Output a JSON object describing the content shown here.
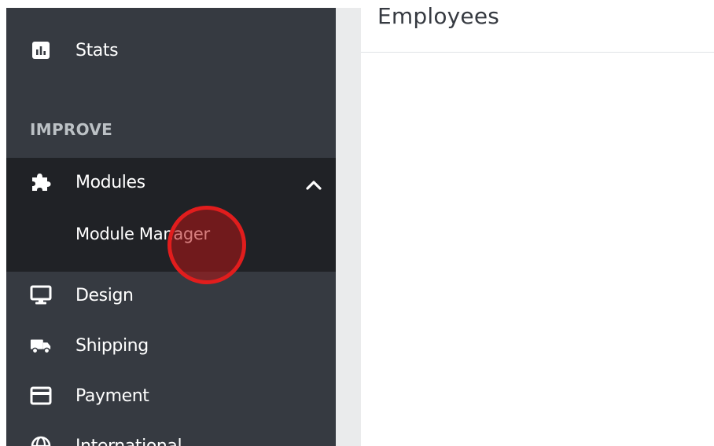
{
  "main": {
    "title": "Employees"
  },
  "sidebar": {
    "items_top": [
      {
        "label": "Stats",
        "icon": "stats-icon"
      }
    ],
    "section_title": "IMPROVE",
    "modules": {
      "label": "Modules",
      "icon": "puzzle-icon",
      "expanded": true,
      "submenu": [
        {
          "label": "Module Manager"
        }
      ]
    },
    "items_bottom": [
      {
        "label": "Design",
        "icon": "monitor-icon"
      },
      {
        "label": "Shipping",
        "icon": "truck-icon"
      },
      {
        "label": "Payment",
        "icon": "credit-card-icon"
      },
      {
        "label": "International",
        "icon": "globe-icon"
      }
    ]
  },
  "colors": {
    "sidebar_bg": "#363a41",
    "active_bg": "#202226",
    "section_text": "#bcc1c5",
    "cursor_ring": "#e11d1d"
  }
}
